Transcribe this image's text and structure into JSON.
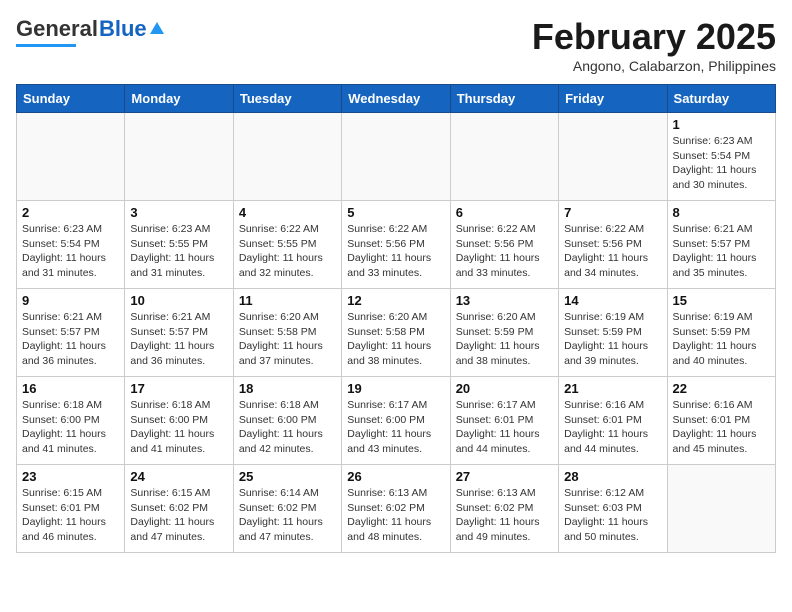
{
  "header": {
    "logo_general": "General",
    "logo_blue": "Blue",
    "month_title": "February 2025",
    "location": "Angono, Calabarzon, Philippines"
  },
  "columns": [
    "Sunday",
    "Monday",
    "Tuesday",
    "Wednesday",
    "Thursday",
    "Friday",
    "Saturday"
  ],
  "weeks": [
    [
      {
        "day": "",
        "info": ""
      },
      {
        "day": "",
        "info": ""
      },
      {
        "day": "",
        "info": ""
      },
      {
        "day": "",
        "info": ""
      },
      {
        "day": "",
        "info": ""
      },
      {
        "day": "",
        "info": ""
      },
      {
        "day": "1",
        "info": "Sunrise: 6:23 AM\nSunset: 5:54 PM\nDaylight: 11 hours\nand 30 minutes."
      }
    ],
    [
      {
        "day": "2",
        "info": "Sunrise: 6:23 AM\nSunset: 5:54 PM\nDaylight: 11 hours\nand 31 minutes."
      },
      {
        "day": "3",
        "info": "Sunrise: 6:23 AM\nSunset: 5:55 PM\nDaylight: 11 hours\nand 31 minutes."
      },
      {
        "day": "4",
        "info": "Sunrise: 6:22 AM\nSunset: 5:55 PM\nDaylight: 11 hours\nand 32 minutes."
      },
      {
        "day": "5",
        "info": "Sunrise: 6:22 AM\nSunset: 5:56 PM\nDaylight: 11 hours\nand 33 minutes."
      },
      {
        "day": "6",
        "info": "Sunrise: 6:22 AM\nSunset: 5:56 PM\nDaylight: 11 hours\nand 33 minutes."
      },
      {
        "day": "7",
        "info": "Sunrise: 6:22 AM\nSunset: 5:56 PM\nDaylight: 11 hours\nand 34 minutes."
      },
      {
        "day": "8",
        "info": "Sunrise: 6:21 AM\nSunset: 5:57 PM\nDaylight: 11 hours\nand 35 minutes."
      }
    ],
    [
      {
        "day": "9",
        "info": "Sunrise: 6:21 AM\nSunset: 5:57 PM\nDaylight: 11 hours\nand 36 minutes."
      },
      {
        "day": "10",
        "info": "Sunrise: 6:21 AM\nSunset: 5:57 PM\nDaylight: 11 hours\nand 36 minutes."
      },
      {
        "day": "11",
        "info": "Sunrise: 6:20 AM\nSunset: 5:58 PM\nDaylight: 11 hours\nand 37 minutes."
      },
      {
        "day": "12",
        "info": "Sunrise: 6:20 AM\nSunset: 5:58 PM\nDaylight: 11 hours\nand 38 minutes."
      },
      {
        "day": "13",
        "info": "Sunrise: 6:20 AM\nSunset: 5:59 PM\nDaylight: 11 hours\nand 38 minutes."
      },
      {
        "day": "14",
        "info": "Sunrise: 6:19 AM\nSunset: 5:59 PM\nDaylight: 11 hours\nand 39 minutes."
      },
      {
        "day": "15",
        "info": "Sunrise: 6:19 AM\nSunset: 5:59 PM\nDaylight: 11 hours\nand 40 minutes."
      }
    ],
    [
      {
        "day": "16",
        "info": "Sunrise: 6:18 AM\nSunset: 6:00 PM\nDaylight: 11 hours\nand 41 minutes."
      },
      {
        "day": "17",
        "info": "Sunrise: 6:18 AM\nSunset: 6:00 PM\nDaylight: 11 hours\nand 41 minutes."
      },
      {
        "day": "18",
        "info": "Sunrise: 6:18 AM\nSunset: 6:00 PM\nDaylight: 11 hours\nand 42 minutes."
      },
      {
        "day": "19",
        "info": "Sunrise: 6:17 AM\nSunset: 6:00 PM\nDaylight: 11 hours\nand 43 minutes."
      },
      {
        "day": "20",
        "info": "Sunrise: 6:17 AM\nSunset: 6:01 PM\nDaylight: 11 hours\nand 44 minutes."
      },
      {
        "day": "21",
        "info": "Sunrise: 6:16 AM\nSunset: 6:01 PM\nDaylight: 11 hours\nand 44 minutes."
      },
      {
        "day": "22",
        "info": "Sunrise: 6:16 AM\nSunset: 6:01 PM\nDaylight: 11 hours\nand 45 minutes."
      }
    ],
    [
      {
        "day": "23",
        "info": "Sunrise: 6:15 AM\nSunset: 6:01 PM\nDaylight: 11 hours\nand 46 minutes."
      },
      {
        "day": "24",
        "info": "Sunrise: 6:15 AM\nSunset: 6:02 PM\nDaylight: 11 hours\nand 47 minutes."
      },
      {
        "day": "25",
        "info": "Sunrise: 6:14 AM\nSunset: 6:02 PM\nDaylight: 11 hours\nand 47 minutes."
      },
      {
        "day": "26",
        "info": "Sunrise: 6:13 AM\nSunset: 6:02 PM\nDaylight: 11 hours\nand 48 minutes."
      },
      {
        "day": "27",
        "info": "Sunrise: 6:13 AM\nSunset: 6:02 PM\nDaylight: 11 hours\nand 49 minutes."
      },
      {
        "day": "28",
        "info": "Sunrise: 6:12 AM\nSunset: 6:03 PM\nDaylight: 11 hours\nand 50 minutes."
      },
      {
        "day": "",
        "info": ""
      }
    ]
  ]
}
